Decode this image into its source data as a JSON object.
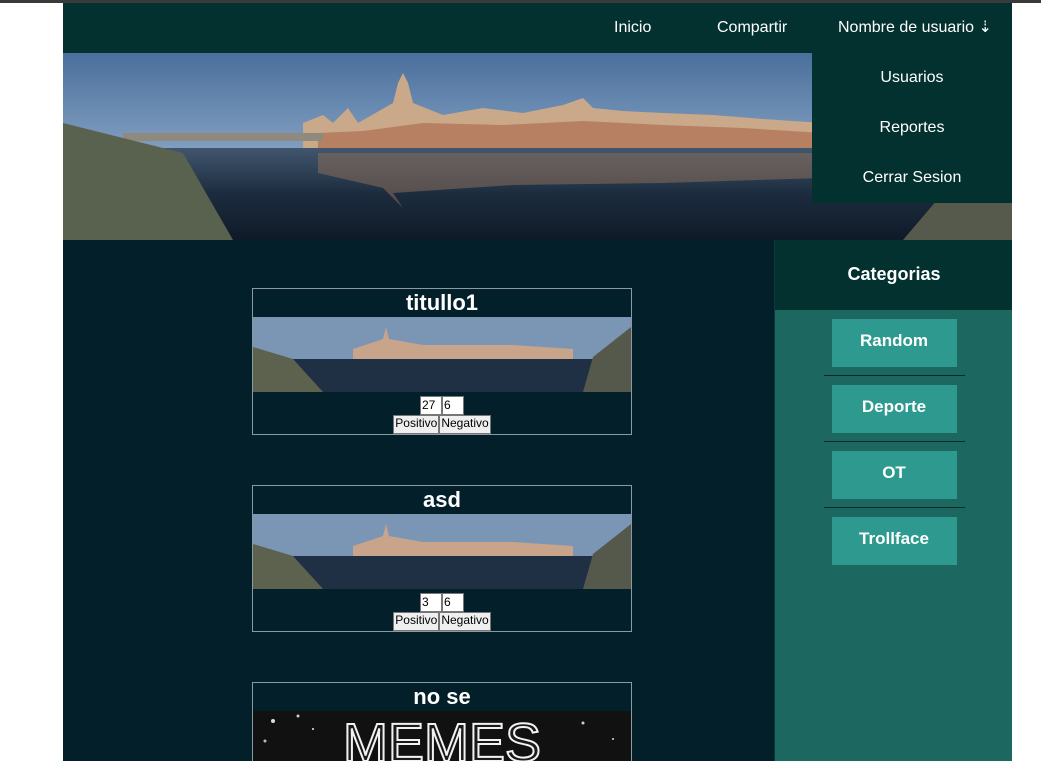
{
  "nav": {
    "home": "Inicio",
    "share": "Compartir",
    "user": "Nombre de usuario ⇣"
  },
  "dropdown": {
    "items": [
      "Usuarios",
      "Reportes",
      "Cerrar Sesion"
    ]
  },
  "sidebar": {
    "title": "Categorias",
    "categories": [
      "Random",
      "Deporte",
      "OT",
      "Trollface"
    ]
  },
  "posts": [
    {
      "title": "titullo1",
      "positive_count": "27",
      "negative_count": "6",
      "positive_label": "Positivo",
      "negative_label": "Negativo"
    },
    {
      "title": "asd",
      "positive_count": "3",
      "negative_count": "6",
      "positive_label": "Positivo",
      "negative_label": "Negativo"
    },
    {
      "title": "no se",
      "image_text": "MEMES"
    }
  ],
  "colors": {
    "nav_bg": "#033130",
    "page_bg": "#03202a",
    "sidebar_bg": "#1c6861",
    "category_button": "#2e9a8f"
  }
}
